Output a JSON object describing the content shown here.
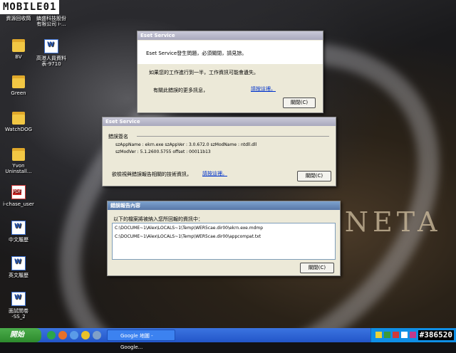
{
  "logo": {
    "text": "MOBILE01"
  },
  "desktop": {
    "brand_text": "ENETA",
    "icons": [
      {
        "label": "資源回收筒",
        "type": "recycle"
      },
      {
        "label": "鎮盛科技股份\n有限公司 i-...",
        "type": "doc"
      },
      {
        "label": "BV",
        "type": "folder"
      },
      {
        "label": "高港人員資料\n表-9710",
        "type": "doc"
      },
      {
        "label": "Green",
        "type": "folder"
      },
      {
        "label": "WatchDOG",
        "type": "folder"
      },
      {
        "label": "Yvon\nUninstall...",
        "type": "folder"
      },
      {
        "label": "i-chase_user",
        "type": "pdf"
      },
      {
        "label": "中文履歷",
        "type": "doc"
      },
      {
        "label": "英文履歷",
        "type": "doc"
      },
      {
        "label": "面試問卷\n-SS_2",
        "type": "doc"
      }
    ]
  },
  "dialog1": {
    "title": "Eset Service",
    "message": "Eset Service發生問題，必須關閉，請見諒。",
    "warning": "如果您的工作進行到一半，工作資訊可能會遺失。",
    "more_info": "有關此錯誤的更多訊息，",
    "link": "請按這裡。",
    "close_button": "關閉(C)"
  },
  "dialog2": {
    "title": "Eset Service",
    "section_label": "錯誤簽名",
    "line1": "szAppName : ekrn.exe    szAppVer : 3.0.672.0    szModName : ntdll.dll",
    "line2": "szModVer : 5.1.2600.5755    offset : 00011b13",
    "tech_info": "欲檢視與錯誤報告相關的技術資訊，",
    "link": "請按這裡。",
    "close_button": "關閉(C)"
  },
  "dialog3": {
    "title": "錯誤報告內容",
    "subtitle": "以下的檔案將被納入您所回報的資訊中：",
    "files": [
      "C:\\DOCUME~1\\Alex\\LOCALS~1\\Temp\\WER5cae.dir00\\ekrn.exe.mdmp",
      "C:\\DOCUME~1\\Alex\\LOCALS~1\\Temp\\WER5cae.dir00\\appcompat.txt"
    ],
    "close_button": "關閉(C)"
  },
  "taskbar": {
    "start_label": "開始",
    "task_label": "Google 地圖 - Google...",
    "watermark": "#386520"
  }
}
